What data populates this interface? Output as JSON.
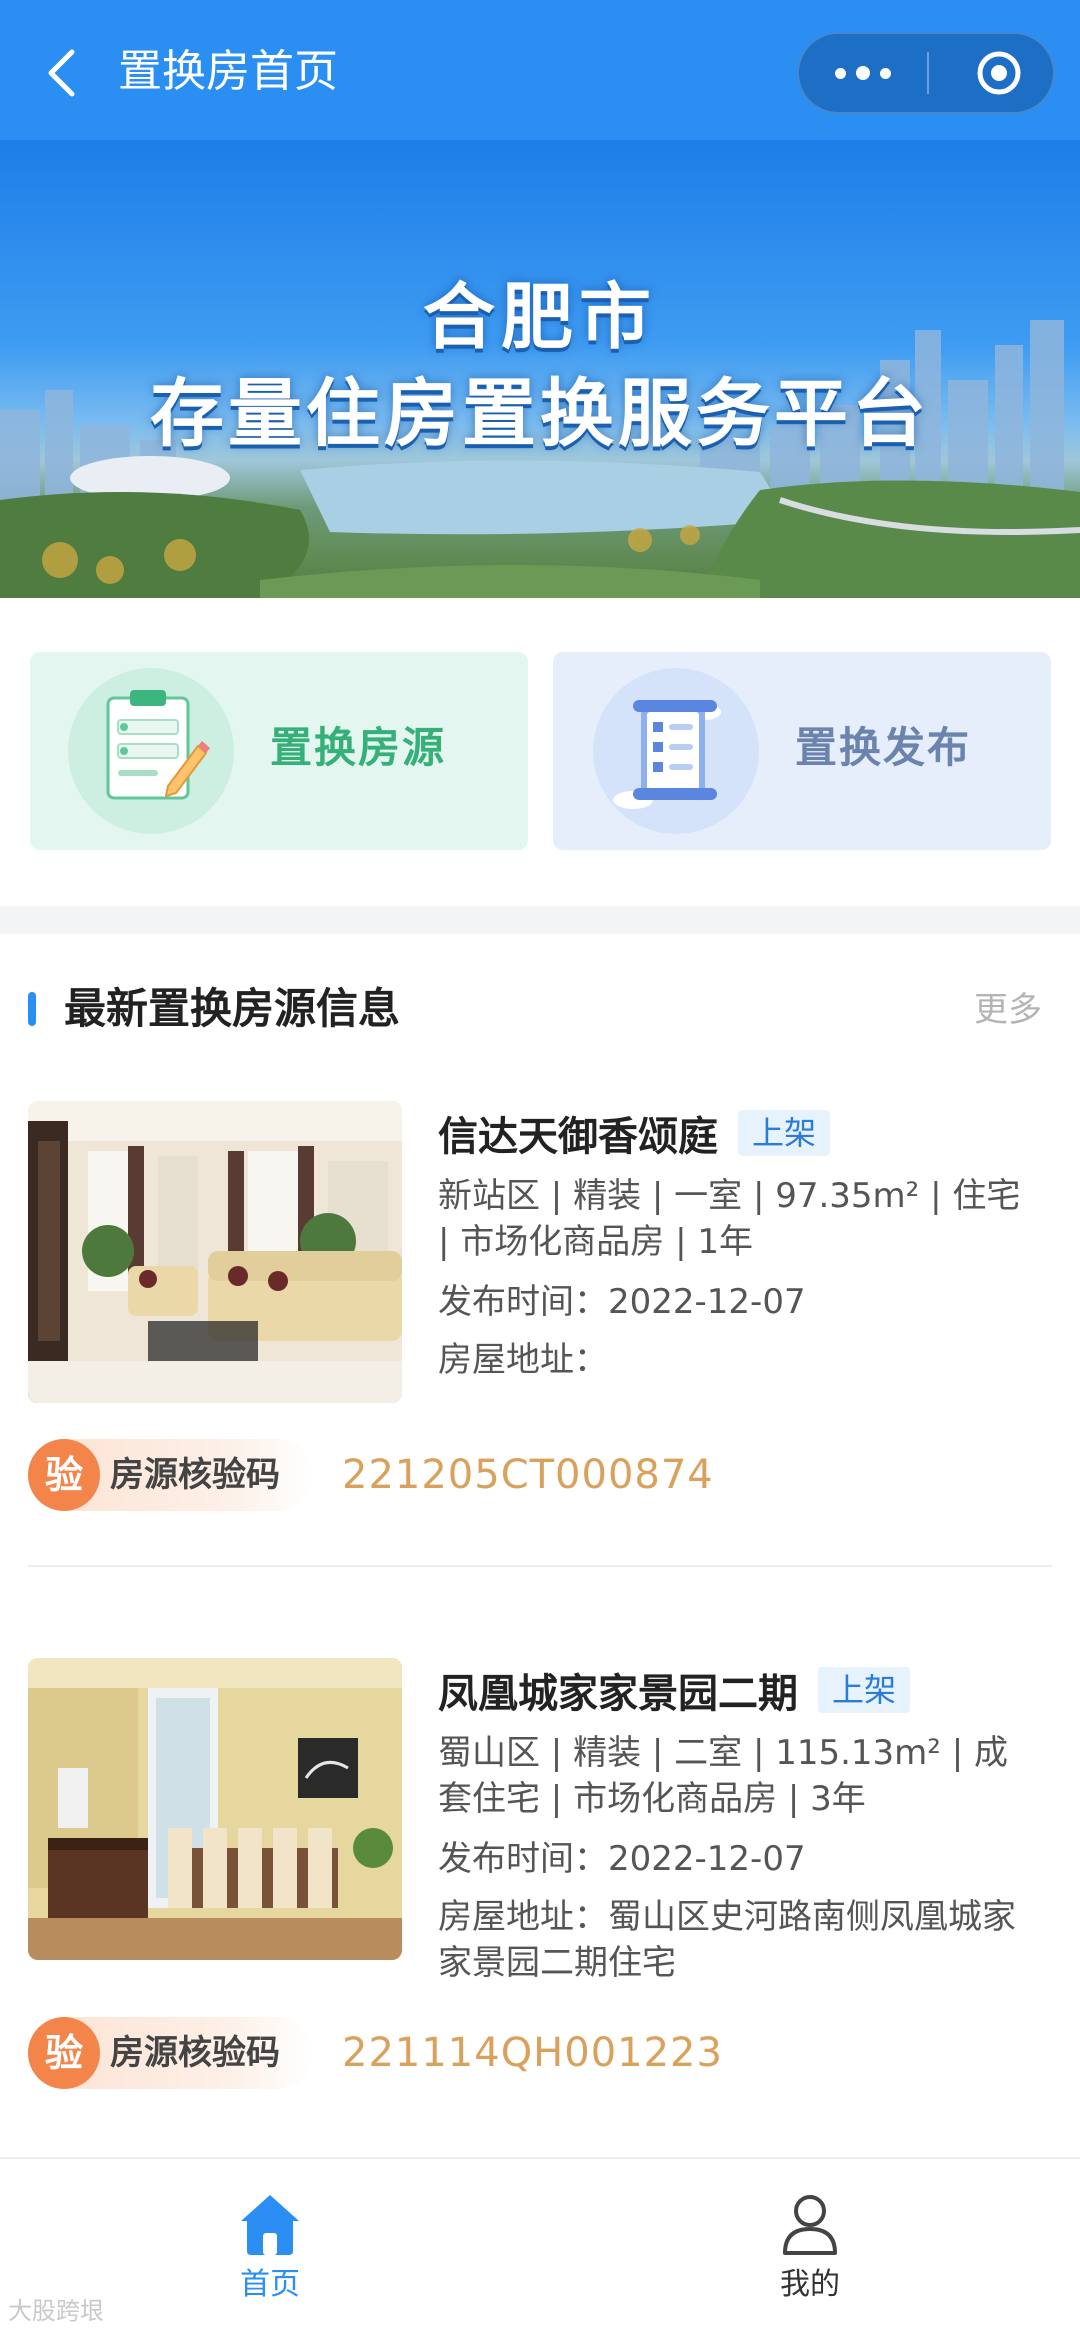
{
  "header": {
    "title": "置换房首页"
  },
  "banner": {
    "line1": "合肥市",
    "line2": "存量住房置换服务平台"
  },
  "quick_actions": [
    {
      "label": "置换房源",
      "icon": "clipboard-form-icon",
      "color": "#36b079"
    },
    {
      "label": "置换发布",
      "icon": "checklist-scroll-icon",
      "color": "#6b84ad"
    }
  ],
  "section": {
    "title": "最新置换房源信息",
    "more": "更多"
  },
  "listings": [
    {
      "name": "信达天御香颂庭",
      "status": "上架",
      "desc": "新站区 | 精装 | 一室 | 97.35m² | 住宅 | 市场化商品房 | 1年",
      "time": "发布时间：2022-12-07",
      "address": "房屋地址：",
      "verify_badge": "验",
      "verify_label": "房源核验码",
      "verify_code": "221205CT000874"
    },
    {
      "name": "凤凰城家家景园二期",
      "status": "上架",
      "desc": "蜀山区 | 精装 | 二室 | 115.13m² | 成套住宅 | 市场化商品房 | 3年",
      "time": "发布时间：2022-12-07",
      "address": "房屋地址：蜀山区史河路南侧凤凰城家家景园二期住宅",
      "verify_badge": "验",
      "verify_label": "房源核验码",
      "verify_code": "221114QH001223"
    }
  ],
  "tabbar": {
    "home": "首页",
    "mine": "我的",
    "active_color": "#2a8ef3"
  },
  "watermark": "大股跨垠"
}
